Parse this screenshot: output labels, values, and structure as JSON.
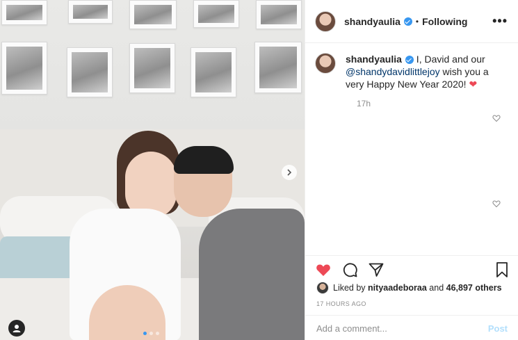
{
  "header": {
    "username": "shandyaulia",
    "separator": "•",
    "follow_status": "Following",
    "more_label": "•••"
  },
  "caption": {
    "username": "shandyaulia",
    "text_before": " I, David and our ",
    "mention": "@shandydavidlittlejoy",
    "text_after": " wish you a very Happy New Year 2020! ",
    "emoji": "❤",
    "time": "17h"
  },
  "engagement": {
    "liked_by_prefix": "Liked by ",
    "liked_by_user": "nityaadeboraa",
    "and_text": " and ",
    "others_count": "46,897 others",
    "timestamp": "17 HOURS AGO"
  },
  "comment_input": {
    "placeholder": "Add a comment...",
    "post_label": "Post"
  },
  "colors": {
    "like_active": "#ed4956",
    "verified": "#3897f0",
    "post_disabled": "#b2dffc",
    "carousel_active": "#3897f0"
  },
  "carousel": {
    "total": 3,
    "active": 1
  }
}
